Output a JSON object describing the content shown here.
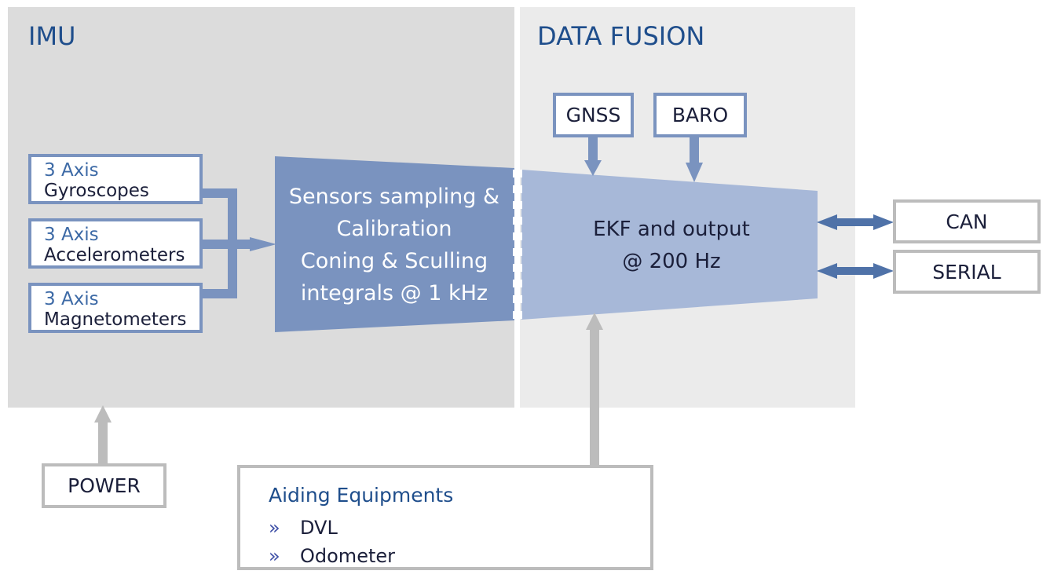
{
  "panels": {
    "imu": {
      "title": "IMU"
    },
    "data_fusion": {
      "title": "DATA FUSION"
    }
  },
  "sensors": [
    {
      "axis": "3 Axis",
      "name": "Gyroscopes"
    },
    {
      "axis": "3 Axis",
      "name": "Accelerometers"
    },
    {
      "axis": "3 Axis",
      "name": "Magnetometers"
    }
  ],
  "processing_block": {
    "lines": [
      "Sensors sampling &",
      "Calibration",
      "Coning & Sculling",
      "integrals @ 1 kHz"
    ]
  },
  "fusion_block": {
    "lines": [
      "EKF and output",
      "@ 200 Hz"
    ]
  },
  "fusion_inputs": [
    {
      "label": "GNSS"
    },
    {
      "label": "BARO"
    }
  ],
  "outputs": [
    {
      "label": "CAN"
    },
    {
      "label": "SERIAL"
    }
  ],
  "power": {
    "label": "POWER"
  },
  "aiding": {
    "title": "Aiding Equipments",
    "bullet": "»",
    "items": [
      "DVL",
      "Odometer"
    ]
  },
  "colors": {
    "imu_bg": "#dcdcdc",
    "fusion_bg": "#ebebeb",
    "block_dark": "#7a93bf",
    "block_light": "#a7b8d8",
    "arrow_blue": "#4f72a8",
    "arrow_gray": "#bcbcbc",
    "title_blue": "#1f4e8c"
  }
}
